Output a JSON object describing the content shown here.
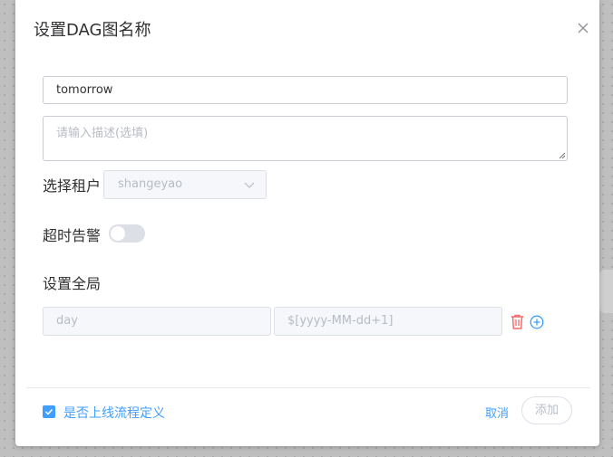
{
  "dialog": {
    "title": "设置DAG图名称",
    "name_value": "tomorrow",
    "description_placeholder": "请输入描述(选填)"
  },
  "tenant": {
    "label": "选择租户",
    "selected": "shangeyao"
  },
  "timeout_alarm": {
    "label": "超时告警",
    "enabled": false
  },
  "global_params": {
    "label": "设置全局",
    "rows": [
      {
        "key_placeholder": "day",
        "value_placeholder": "$[yyyy-MM-dd+1]"
      }
    ]
  },
  "footer": {
    "checkbox_label": "是否上线流程定义",
    "checkbox_checked": true,
    "cancel_label": "取消",
    "add_label": "添加"
  },
  "colors": {
    "primary": "#409eff",
    "danger": "#f56c6c"
  },
  "icons": [
    "close-icon",
    "chevron-down-icon",
    "delete-icon",
    "add-circle-icon",
    "check-icon"
  ]
}
